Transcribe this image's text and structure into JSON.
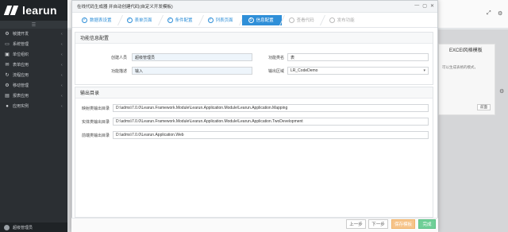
{
  "sidebar": {
    "logo": "learun",
    "items": [
      {
        "icon": "⚙",
        "label": "敏捷开发",
        "icon_name": "gear-icon"
      },
      {
        "icon": "▭",
        "label": "系统管理",
        "icon_name": "monitor-icon"
      },
      {
        "icon": "▣",
        "label": "单位组织",
        "icon_name": "org-icon"
      },
      {
        "icon": "✉",
        "label": "表单应用",
        "icon_name": "mail-icon"
      },
      {
        "icon": "↻",
        "label": "流程应用",
        "icon_name": "flow-icon"
      },
      {
        "icon": "⚙",
        "label": "移动管理",
        "icon_name": "mobile-gear-icon"
      },
      {
        "icon": "▤",
        "label": "报表应用",
        "icon_name": "report-icon"
      },
      {
        "icon": "●",
        "label": "应用实例",
        "icon_name": "app-icon"
      }
    ],
    "user": "超级管理员"
  },
  "background": {
    "excel_title": "EXCEl风格模板",
    "excel_desc": "可以生成表格的模式，",
    "excel_btn": "前面"
  },
  "modal": {
    "title": "在线代码生成器 并自动创建代码(自定义开发模板)",
    "steps": [
      {
        "label": "数据表设置",
        "state": "done"
      },
      {
        "label": "表单页面",
        "state": "done"
      },
      {
        "label": "条件配置",
        "state": "done"
      },
      {
        "label": "列表页面",
        "state": "done"
      },
      {
        "label": "信息配置",
        "state": "active",
        "num": "5"
      },
      {
        "label": "查看代码",
        "state": "pending"
      },
      {
        "label": "发布功能",
        "state": "pending"
      }
    ],
    "info_section": {
      "title": "功能信息配置",
      "creator_label": "创建人员",
      "creator_value": "超级管理员",
      "func_name_label": "功能类名",
      "func_name_value": "表",
      "func_desc_label": "功能描述",
      "func_desc_value": "输入",
      "output_area_label": "输出区域",
      "output_area_value": "LR_CodeDemo"
    },
    "output_section": {
      "title": "输出目录",
      "rows": [
        {
          "label": "映射类输出目录",
          "value": "D:\\adms\\7.0.0\\Learun.Framework.Module\\Learun.Application.Module\\Learun.Application.Mapping"
        },
        {
          "label": "实体类输出目录",
          "value": "D:\\adms\\7.0.0\\Learun.Framework.Module\\Learun.Application.Module\\Learun.Application.TwoDevelopment"
        },
        {
          "label": "前端类输出目录",
          "value": "D:\\adms\\7.0.0\\Learun.Application.Web"
        }
      ]
    },
    "footer": {
      "prev": "上一步",
      "next": "下一步",
      "generate": "保存模板",
      "finish": "完成"
    }
  }
}
